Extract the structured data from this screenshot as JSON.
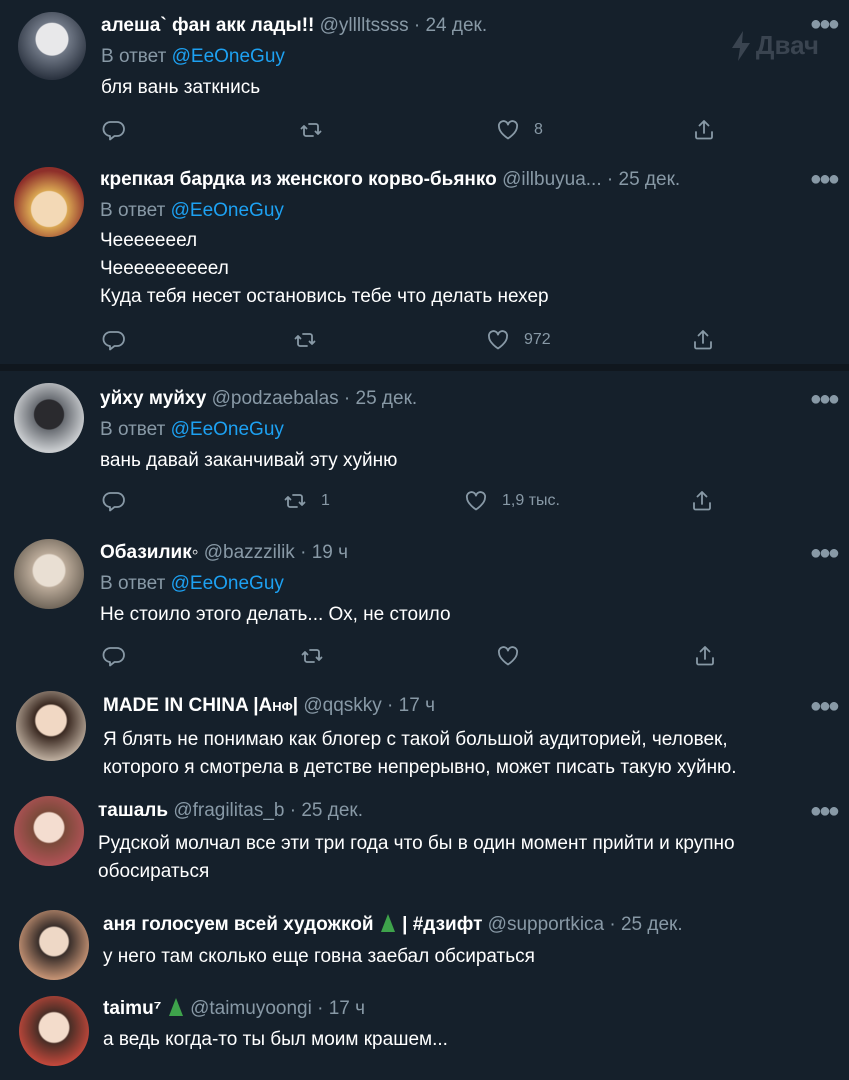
{
  "watermark": "Двач",
  "reply_prefix": "В ответ",
  "tweets": [
    {
      "name": "алеша` фан акк лады!!",
      "meta": "@ylllltssss · 24 дек.",
      "reply_to": "@EeOneGuy",
      "lines": [
        "бля вань заткнись"
      ],
      "likes": "8",
      "retweets": ""
    },
    {
      "name": "крепкая бардка из женского корво-бьянко",
      "meta": "@illbuyua...   · 25 дек.",
      "reply_to": "@EeOneGuy",
      "lines": [
        "Чееееееел",
        "Чеееееееееел",
        "Куда тебя несет остановись тебе что делать нехер"
      ],
      "likes": "972",
      "retweets": ""
    },
    {
      "name": "уйху муйху",
      "meta": "@podzaebalas · 25 дек.",
      "reply_to": "@EeOneGuy",
      "lines": [
        "вань давай заканчивай эту хуйню"
      ],
      "likes": "1,9 тыс.",
      "retweets": "1"
    },
    {
      "name": "Обазилик◦",
      "meta": "@bazzzilik · 19 ч",
      "reply_to": "@EeOneGuy",
      "lines": [
        "Не стоило этого делать... Ох, не стоило"
      ],
      "likes": "",
      "retweets": ""
    },
    {
      "name": "MADE IN CHINA |Анф|",
      "meta": "@qqskky · 17 ч",
      "lines": [
        "Я блять не понимаю как блогер с такой большой аудиторией, человек,",
        "которого я смотрела в детстве непрерывно, может писать такую хуйню."
      ]
    },
    {
      "name": "ташаль",
      "meta": "@fragilitas_b · 25 дек.",
      "lines": [
        "Рудской молчал все эти три года что бы в один момент прийти и крупно",
        "обосираться"
      ]
    },
    {
      "name": "аня голосуем всей художкой",
      "name_tail": "| #дзифт",
      "meta": "@supportkica · 25 дек.",
      "lines": [
        "у него там сколько еще говна заебал обсираться"
      ]
    },
    {
      "name": "taimu⁷",
      "meta": "@taimuyoongi · 17 ч",
      "lines": [
        "а ведь когда-то ты был моим крашем..."
      ]
    }
  ],
  "colors": {
    "background": "#15202b",
    "separator": "#10171e",
    "text": "#ffffff",
    "muted": "#8899a6",
    "link": "#1da1f2"
  }
}
